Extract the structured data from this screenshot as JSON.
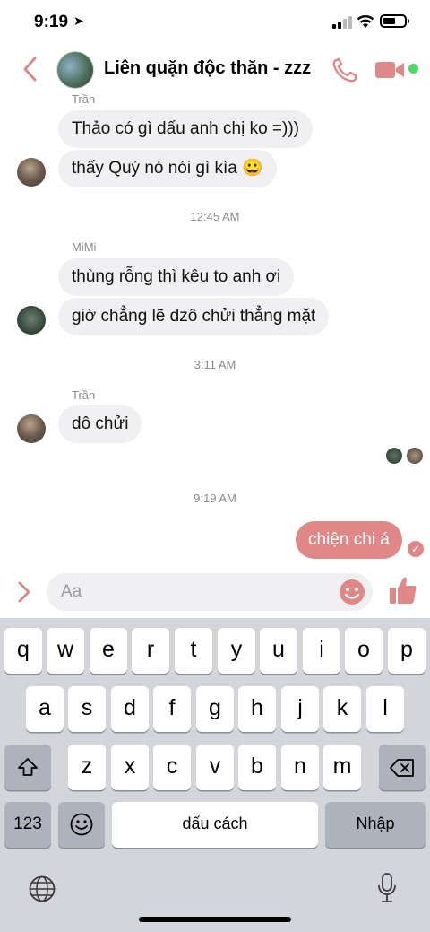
{
  "status_bar": {
    "time": "9:19"
  },
  "header": {
    "group_name": "Liên quặn độc thăn - zzz"
  },
  "messages": {
    "sender1": "Trần",
    "m1": "Thảo có gì dấu anh chị ko =)))",
    "m2": "thấy Quý nó nói gì kìa 😀",
    "time1": "12:45 AM",
    "sender2": "MiMi",
    "m3": "thùng rỗng thì kêu to anh ơi",
    "m4": "giờ chẳng lẽ dzô chửi thẳng mặt",
    "time2": "3:11 AM",
    "sender3": "Trần",
    "m5": "dô chửi",
    "time3": "9:19 AM",
    "mine": "chiện chi á"
  },
  "composer": {
    "placeholder": "Aa"
  },
  "keyboard": {
    "row1": [
      "q",
      "w",
      "e",
      "r",
      "t",
      "y",
      "u",
      "i",
      "o",
      "p"
    ],
    "row2": [
      "a",
      "s",
      "d",
      "f",
      "g",
      "h",
      "j",
      "k",
      "l"
    ],
    "row3": [
      "z",
      "x",
      "c",
      "v",
      "b",
      "n",
      "m"
    ],
    "numbers_key": "123",
    "space_key": "dấu cách",
    "return_key": "Nhập"
  },
  "colors": {
    "accent": "#e08888",
    "online": "#4cd964"
  }
}
